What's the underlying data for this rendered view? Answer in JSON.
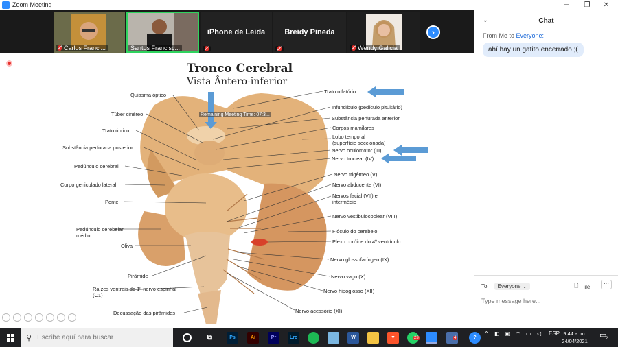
{
  "window": {
    "title": "Zoom Meeting"
  },
  "participants": [
    {
      "name": "Carlos Franci...",
      "muted": true
    },
    {
      "name": "Santos Francisc...",
      "muted": true,
      "active": true
    },
    {
      "name": "iPhone de Leida",
      "muted": true
    },
    {
      "name": "Breidy Pineda",
      "muted": true
    },
    {
      "name": "Wendy Galicia",
      "muted": true
    }
  ],
  "share": {
    "tooltip": "Remaining Meeting Time: 07:3...",
    "slide_title": "Tronco Cerebral",
    "slide_subtitle": "Vista Ântero-inferior",
    "labels_left": [
      "Quiasma óptico",
      "Túber cinéreo",
      "Trato óptico",
      "Substância perfurada posterior",
      "Pedúnculo cerebral",
      "Corpo geniculado lateral",
      "Ponte",
      "Pedúnculo cerebelar médio",
      "Oliva",
      "Pirâmide",
      "Raízes ventrais do 1º nervo espinhal (C1)",
      "Decussação das pirâmides"
    ],
    "labels_right": [
      "Trato olfatório",
      "Infundíbulo (pedículo pituitário)",
      "Substância perfurada anterior",
      "Corpos mamilares",
      "Lobo temporal (superfície seccionada)",
      "Nervo oculomotor (III)",
      "Nervo troclear (IV)",
      "Nervo trigêmeo (V)",
      "Nervo abducente (VI)",
      "Nervos facial (VII) e intermédio",
      "Nervo vestibulococlear (VIII)",
      "Flóculo do cerebelo",
      "Plexo coróide do 4º ventrículo",
      "Nervo glossofaríngeo (IX)",
      "Nervo vago (X)",
      "Nervo hipoglosso (XII)",
      "Nervo acessório (XI)"
    ]
  },
  "chat": {
    "title": "Chat",
    "from_prefix": "From Me to",
    "from_target": "Everyone:",
    "message": "ahí hay un gatito encerrado ;(",
    "to_label": "To:",
    "to_value": "Everyone",
    "file_label": "File",
    "more_label": "···",
    "input_placeholder": "Type message here..."
  },
  "taskbar": {
    "search_placeholder": "Escribe aquí para buscar",
    "apps": [
      "task-view",
      "photoshop",
      "illustrator",
      "premiere",
      "lightroom-classic",
      "spotify",
      "chrome-alt",
      "word",
      "file-explorer",
      "brave",
      "whatsapp",
      "zoom",
      "notifications-app",
      "help"
    ],
    "whatsapp_badge": "23",
    "app_badge": "4",
    "lang": "ESP",
    "time": "9:44 a. m.",
    "date": "24/04/2021",
    "notif_count": "2"
  },
  "colors": {
    "zoom_blue": "#2D8CFF",
    "muted_red": "#E5302B",
    "active_green": "#2FD35E",
    "arrow_blue": "#5B9BD5"
  }
}
